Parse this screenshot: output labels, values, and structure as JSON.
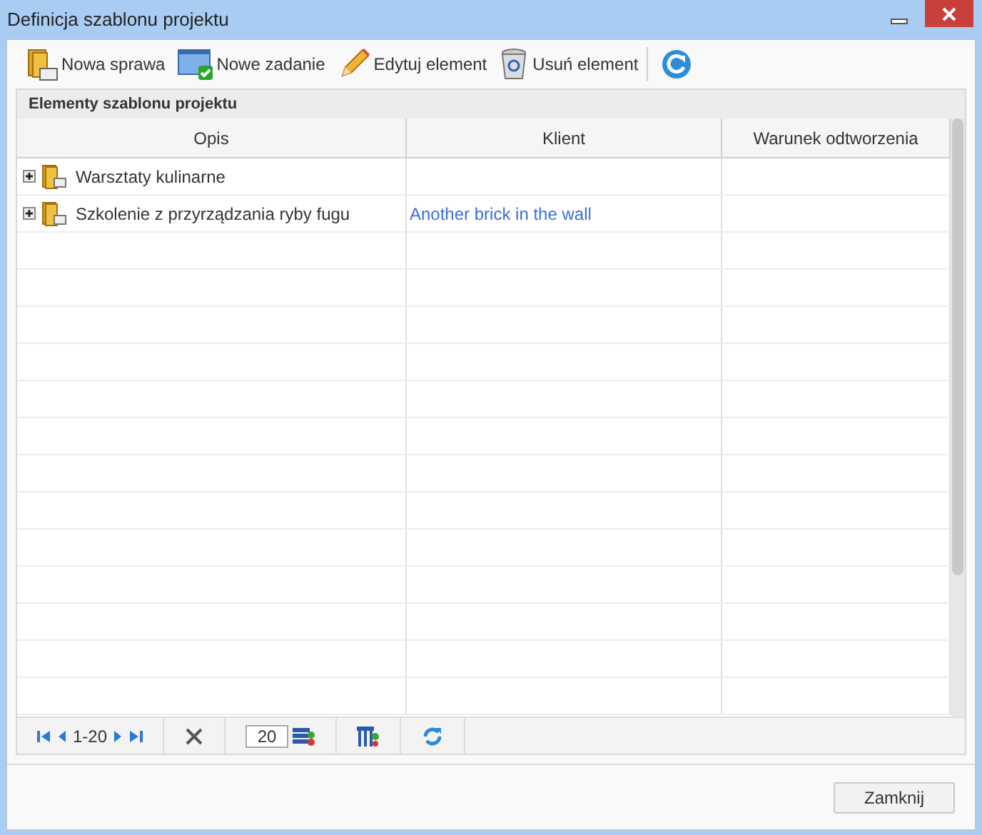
{
  "window": {
    "title": "Definicja szablonu projektu"
  },
  "toolbar": [
    {
      "kind": "folder",
      "label": "Nowa sprawa"
    },
    {
      "kind": "task",
      "label": "Nowe zadanie"
    },
    {
      "kind": "pencil",
      "label": "Edytuj element"
    },
    {
      "kind": "trash",
      "label": "Usuń element"
    },
    {
      "kind": "refresh"
    }
  ],
  "panel": {
    "title": "Elementy szablonu projektu"
  },
  "table": {
    "columns": [
      "Opis",
      "Klient",
      "Warunek odtworzenia"
    ],
    "rows": [
      {
        "expanded": false,
        "opis": "Warsztaty kulinarne"
      },
      {
        "expanded": false,
        "opis": "Szkolenie z przyrządzania ryby fugu",
        "klient": "Another brick in the wall"
      }
    ]
  },
  "pager": {
    "range": "1-20",
    "page_size": "20"
  },
  "buttons": [
    "Zamknij"
  ]
}
